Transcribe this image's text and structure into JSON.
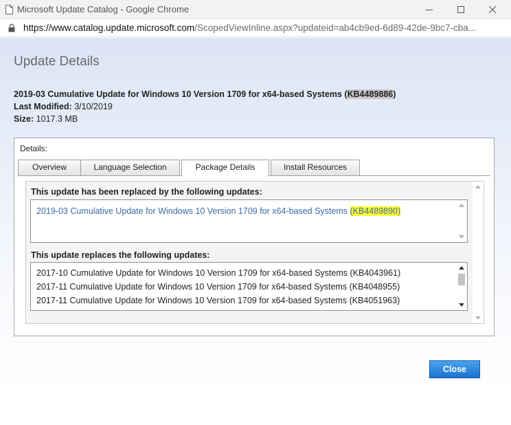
{
  "window": {
    "title": "Microsoft Update Catalog - Google Chrome",
    "url_host": "https://www.catalog.update.microsoft.com",
    "url_path": "/ScopedViewInline.aspx?updateid=ab4cb9ed-6d89-42de-9bc7-cba...",
    "icons": [
      "page-icon",
      "minimize-icon",
      "maximize-icon",
      "close-icon",
      "lock-icon"
    ]
  },
  "page": {
    "heading": "Update Details",
    "update_title": "2019-03 Cumulative Update for Windows 10 Version 1709 for x64-based Systems (",
    "update_kb": "KB4489886",
    "update_title_end": ")",
    "last_modified_label": "Last Modified:",
    "last_modified_value": "3/10/2019",
    "size_label": "Size:",
    "size_value": "1017.3 MB"
  },
  "details": {
    "label": "Details:",
    "tabs": [
      {
        "label": "Overview",
        "active": false
      },
      {
        "label": "Language Selection",
        "active": false
      },
      {
        "label": "Package Details",
        "active": true
      },
      {
        "label": "Install Resources",
        "active": false
      }
    ],
    "replaced_by": {
      "heading": "This update has been replaced by the following updates:",
      "items": [
        {
          "text": "2019-03 Cumulative Update for Windows 10 Version 1709 for x64-based Systems ",
          "kb": "(KB4489890)"
        }
      ]
    },
    "replaces": {
      "heading": "This update replaces the following updates:",
      "items": [
        "2017-10 Cumulative Update for Windows 10 Version 1709 for x64-based Systems (KB4043961)",
        "2017-11 Cumulative Update for Windows 10 Version 1709 for x64-based Systems (KB4048955)",
        "2017-11 Cumulative Update for Windows 10 Version 1709 for x64-based Systems (KB4051963)"
      ]
    }
  },
  "buttons": {
    "close": "Close"
  },
  "colors": {
    "link": "#3a6aa8",
    "highlight": "#ffff30",
    "button": "#1a73d0"
  }
}
